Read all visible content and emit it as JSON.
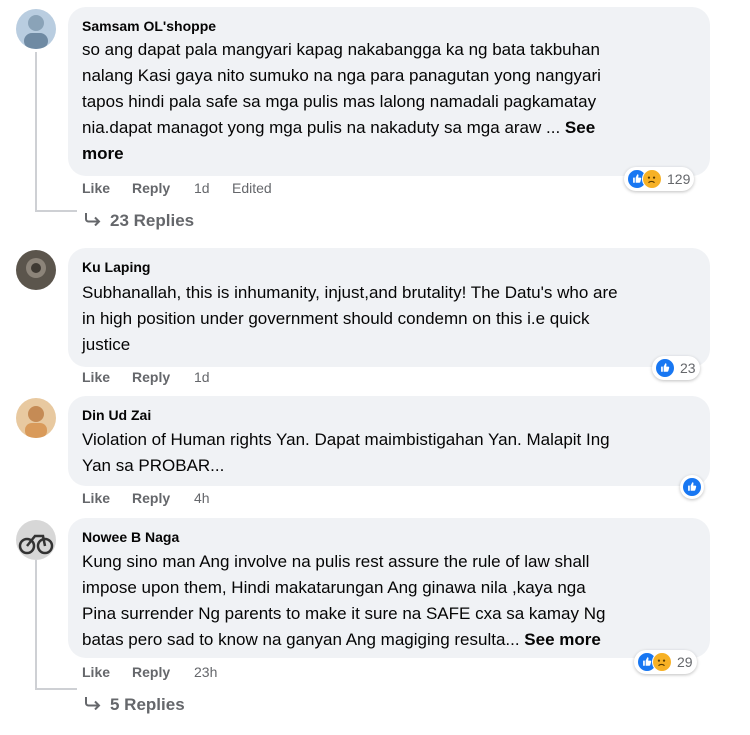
{
  "colors": {
    "bubble": "#f0f2f5",
    "meta_text": "#65676b",
    "like_blue": "#1877f2",
    "sad_yellow": "#f7b125"
  },
  "actions": {
    "like": "Like",
    "reply": "Reply"
  },
  "comments": [
    {
      "author": "Samsam OL'shoppe",
      "lines": [
        "so ang dapat pala mangyari kapag nakabangga ka ng bata takbuhan",
        "nalang Kasi gaya nito sumuko na nga para panagutan yong nangyari",
        "tapos hindi pala safe sa mga pulis mas lalong namadali pagkamatay",
        "nia.dapat managot yong mga pulis na nakaduty sa mga araw ... "
      ],
      "see_more_a": "See",
      "see_more_b": "more",
      "time": "1d",
      "edited": "Edited",
      "reaction_count": "129",
      "replies": "23 Replies"
    },
    {
      "author": "Ku Laping",
      "lines": [
        "Subhanallah, this is inhumanity, injust,and brutality! The Datu's who are",
        "in high position under government should condemn on this i.e quick",
        "justice"
      ],
      "time": "1d",
      "reaction_count": "23"
    },
    {
      "author": "Din Ud Zai",
      "lines": [
        "Violation of Human rights Yan. Dapat maimbistigahan Yan. Malapit Ing",
        "Yan sa PROBAR..."
      ],
      "time": "4h"
    },
    {
      "author": "Nowee B Naga",
      "lines": [
        "Kung sino man Ang involve na pulis rest assure the rule of law shall",
        "impose upon them, Hindi makatarungan Ang ginawa nila ,kaya nga",
        "Pina surrender Ng parents to make it sure na SAFE cxa sa kamay Ng",
        "batas pero sad to know na ganyan Ang magiging resulta... "
      ],
      "see_more": "See more",
      "time": "23h",
      "reaction_count": "29",
      "replies": "5 Replies"
    }
  ]
}
